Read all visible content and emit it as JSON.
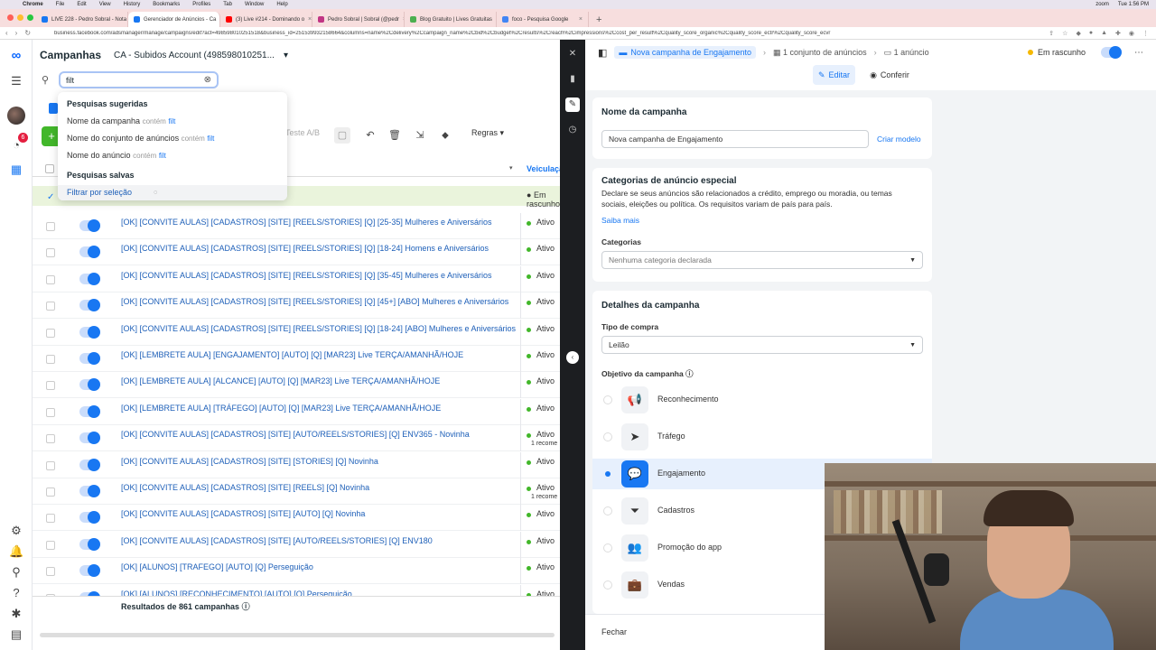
{
  "mac_menu": {
    "items": [
      "Chrome",
      "File",
      "Edit",
      "View",
      "History",
      "Bookmarks",
      "Profiles",
      "Tab",
      "Window",
      "Help"
    ],
    "right_items": [
      "zoom",
      "Tue 1:56 PM"
    ]
  },
  "browser": {
    "tabs": [
      {
        "label": "LIVE 228 - Pedro Sobral - Nota",
        "fav_color": "#1877f2"
      },
      {
        "label": "Gerenciador de Anúncios - Ca",
        "fav_color": "#1877f2",
        "active": true
      },
      {
        "label": "(3) Live #214 - Dominando o",
        "fav_color": "#ff0000"
      },
      {
        "label": "Pedro Sobral | Sobral (@pedr",
        "fav_color": "#c13584"
      },
      {
        "label": "Blog Gratuito | Lives Gratuitas",
        "fav_color": "#4caf50"
      },
      {
        "label": "foco - Pesquisa Google",
        "fav_color": "#4285f4"
      }
    ],
    "url": "business.facebook.com/adsmanager/manage/campaigns/edit?act=498598010251518&business_id=251539932158664&columns=name%2Cdelivery%2Ccampaign_name%2Cbid%2Cbudget%2Cresults%2Creach%2Cimpressions%2Ccost_per_result%2Cquality_score_organic%2Cquality_score_ectr%2Cquality_score_ecvr"
  },
  "campaigns": {
    "title": "Campanhas",
    "account": "CA - Subidos Account (498598010251...",
    "search_value": "filt",
    "toolbar": {
      "ab_test": "Teste A/B",
      "rules": "Regras"
    },
    "delivery_header": "Veiculação",
    "draft_status": "Em rascunho",
    "rows": [
      {
        "name": "[OK] [CONVITE AULAS] [CADASTROS] [SITE] [REELS/STORIES] [Q] [25-35] Mulheres e Aniversários",
        "status": "Ativo",
        "sub": ""
      },
      {
        "name": "[OK] [CONVITE AULAS] [CADASTROS] [SITE] [REELS/STORIES] [Q] [18-24] Homens e Aniversários",
        "status": "Ativo",
        "sub": ""
      },
      {
        "name": "[OK] [CONVITE AULAS] [CADASTROS] [SITE] [REELS/STORIES] [Q] [35-45] Mulheres e Aniversários",
        "status": "Ativo",
        "sub": ""
      },
      {
        "name": "[OK] [CONVITE AULAS] [CADASTROS] [SITE] [REELS/STORIES] [Q] [45+] [ABO] Mulheres e Aniversários",
        "status": "Ativo",
        "sub": ""
      },
      {
        "name": "[OK] [CONVITE AULAS] [CADASTROS] [SITE] [REELS/STORIES] [Q] [18-24] [ABO] Mulheres e Aniversários",
        "status": "Ativo",
        "sub": ""
      },
      {
        "name": "[OK] [LEMBRETE AULA] [ENGAJAMENTO] [AUTO] [Q] [MAR23] Live TERÇA/AMANHÃ/HOJE",
        "status": "Ativo",
        "sub": ""
      },
      {
        "name": "[OK] [LEMBRETE AULA] [ALCANCE] [AUTO] [Q] [MAR23] Live TERÇA/AMANHÃ/HOJE",
        "status": "Ativo",
        "sub": ""
      },
      {
        "name": "[OK] [LEMBRETE AULA] [TRÁFEGO] [AUTO] [Q] [MAR23] Live TERÇA/AMANHÃ/HOJE",
        "status": "Ativo",
        "sub": ""
      },
      {
        "name": "[OK] [CONVITE AULAS] [CADASTROS] [SITE] [AUTO/REELS/STORIES] [Q] ENV365 - Novinha",
        "status": "Ativo",
        "sub": "1 recome"
      },
      {
        "name": "[OK] [CONVITE AULAS] [CADASTROS] [SITE] [STORIES] [Q] Novinha",
        "status": "Ativo",
        "sub": ""
      },
      {
        "name": "[OK] [CONVITE AULAS] [CADASTROS] [SITE] [REELS] [Q] Novinha",
        "status": "Ativo",
        "sub": "1 recome"
      },
      {
        "name": "[OK] [CONVITE AULAS] [CADASTROS] [SITE] [AUTO] [Q] Novinha",
        "status": "Ativo",
        "sub": ""
      },
      {
        "name": "[OK] [CONVITE AULAS] [CADASTROS] [SITE] [AUTO/REELS/STORIES] [Q] ENV180",
        "status": "Ativo",
        "sub": ""
      },
      {
        "name": "[OK] [ALUNOS] [TRAFEGO] [AUTO] [Q] Perseguição",
        "status": "Ativo",
        "sub": ""
      },
      {
        "name": "[OK] [ALUNOS] [RECONHECIMENTO] [AUTO] [Q] Perseguição",
        "status": "Ativo",
        "sub": ""
      }
    ],
    "results": "Resultados de 861 campanhas"
  },
  "suggestions": {
    "heading": "Pesquisas sugeridas",
    "contains": "contém",
    "query": "filt",
    "items": [
      "Nome da campanha",
      "Nome do conjunto de anúncios",
      "Nome do anúncio"
    ],
    "saved_heading": "Pesquisas salvas",
    "saved_item": "Filtrar por seleção"
  },
  "editor": {
    "breadcrumb": {
      "campaign": "Nova campanha de Engajamento",
      "adset": "1 conjunto de anúncios",
      "ad": "1 anúncio",
      "status": "Em rascunho"
    },
    "modes": {
      "edit": "Editar",
      "review": "Conferir"
    },
    "name_card": {
      "title": "Nome da campanha",
      "value": "Nova campanha de Engajamento",
      "template_link": "Criar modelo"
    },
    "special_card": {
      "title": "Categorias de anúncio especial",
      "description": "Declare se seus anúncios são relacionados a crédito, emprego ou moradia, ou temas sociais, eleições ou política. Os requisitos variam de país para país.",
      "learn_more": "Saiba mais",
      "categories_label": "Categorias",
      "categories_value": "Nenhuma categoria declarada"
    },
    "details_card": {
      "title": "Detalhes da campanha",
      "purchase_label": "Tipo de compra",
      "purchase_value": "Leilão",
      "objective_label": "Objetivo da campanha",
      "objectives": [
        {
          "label": "Reconhecimento",
          "icon": "megaphone-icon",
          "glyph": "📢"
        },
        {
          "label": "Tráfego",
          "icon": "cursor-icon",
          "glyph": "➤"
        },
        {
          "label": "Engajamento",
          "icon": "chat-icon",
          "glyph": "💬",
          "selected": true
        },
        {
          "label": "Cadastros",
          "icon": "funnel-icon",
          "glyph": "⏷"
        },
        {
          "label": "Promoção do app",
          "icon": "people-icon",
          "glyph": "👥"
        },
        {
          "label": "Vendas",
          "icon": "briefcase-icon",
          "glyph": "💼"
        }
      ]
    },
    "footer": {
      "close": "Fechar"
    }
  }
}
